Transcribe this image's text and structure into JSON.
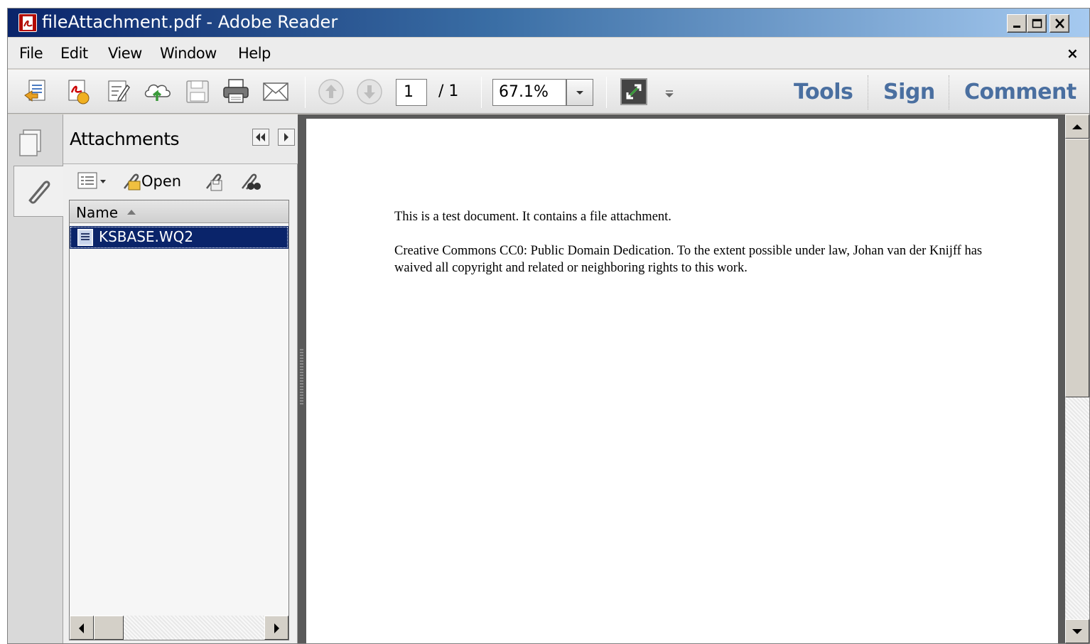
{
  "window": {
    "title": "fileAttachment.pdf - Adobe Reader"
  },
  "menu": {
    "items": [
      "File",
      "Edit",
      "View",
      "Window",
      "Help"
    ],
    "close_glyph": "×"
  },
  "toolbar": {
    "page_current": "1",
    "page_total_text": "/ 1",
    "zoom": "67.1%",
    "links": {
      "tools": "Tools",
      "sign": "Sign",
      "comment": "Comment"
    },
    "icons": [
      "create-pdf-icon",
      "convert-pdf-icon",
      "edit-form-icon",
      "upload-cloud-icon",
      "save-icon",
      "print-icon",
      "email-icon",
      "prev-page-icon",
      "next-page-icon",
      "fit-page-icon",
      "overflow-menu-icon"
    ]
  },
  "attachments_panel": {
    "title": "Attachments",
    "open_label": "Open",
    "column_name": "Name",
    "files": [
      "KSBASE.WQ2"
    ]
  },
  "document": {
    "paragraph1": "This is a test document. It contains a file attachment.",
    "paragraph2": "Creative Commons CC0: Public Domain Dedication. To the extent possible under law, Johan van der Knijff has waived all copyright and related or neighboring rights to this work."
  },
  "colors": {
    "title_gradient_start": "#0a246a",
    "title_gradient_end": "#a6caf0",
    "toolbar_link": "#4a6fa0",
    "selection": "#0a246a"
  }
}
